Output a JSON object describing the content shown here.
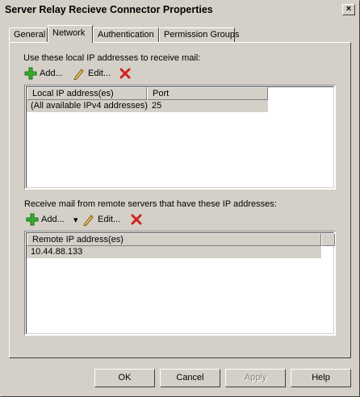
{
  "window": {
    "title": "Server Relay Recieve Connector Properties",
    "close_glyph": "×"
  },
  "tabs": [
    {
      "label": "General"
    },
    {
      "label": "Network"
    },
    {
      "label": "Authentication"
    },
    {
      "label": "Permission Groups"
    }
  ],
  "local_section": {
    "label": "Use these local IP addresses to receive mail:",
    "add_label": "Add...",
    "edit_label": "Edit...",
    "columns": [
      "Local IP address(es)",
      "Port"
    ],
    "rows": [
      {
        "address": "(All available IPv4 addresses)",
        "port": "25"
      }
    ]
  },
  "remote_section": {
    "label": "Receive mail from remote servers that have these IP addresses:",
    "add_label": "Add...",
    "dropdown_glyph": "▾",
    "edit_label": "Edit...",
    "columns": [
      "Remote IP address(es)"
    ],
    "rows": [
      {
        "address": "10.44.88.133"
      }
    ]
  },
  "buttons": {
    "ok": "OK",
    "cancel": "Cancel",
    "apply": "Apply",
    "help": "Help"
  },
  "icons": {
    "add": "green-plus-icon",
    "edit": "pencil-icon",
    "remove": "red-x-icon"
  }
}
